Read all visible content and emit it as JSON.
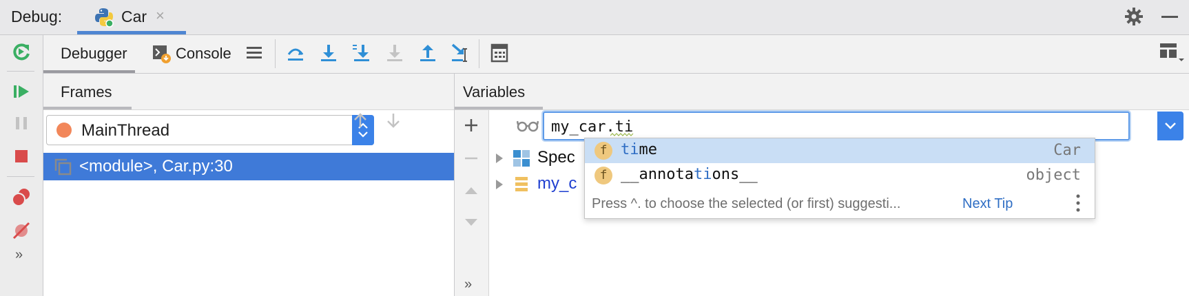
{
  "titlebar": {
    "label": "Debug:",
    "tab_name": "Car",
    "close_glyph": "×",
    "icons": {
      "app": "python-icon",
      "settings": "gear-icon",
      "hide": "minimize-icon"
    }
  },
  "sidebar": {
    "icons": [
      "rerun-icon",
      "resume-icon",
      "pause-icon",
      "stop-icon",
      "view-breakpoints-icon",
      "mute-breakpoints-icon"
    ],
    "more": "»"
  },
  "toolbar": {
    "tabs": [
      {
        "label": "Debugger",
        "active": true
      },
      {
        "label": "Console",
        "active": false
      }
    ],
    "icons": [
      "frames-menu-icon",
      "show-execution-point-icon",
      "step-over-icon",
      "step-into-icon",
      "step-into-my-code-icon",
      "force-step-into-icon",
      "step-out-icon",
      "run-to-cursor-icon",
      "evaluate-expression-icon",
      "layout-icon"
    ]
  },
  "frames": {
    "header": "Frames",
    "thread": "MainThread",
    "frame_row": "<module>, Car.py:30"
  },
  "variables": {
    "header": "Variables",
    "eval_value": "my_car.ti",
    "rows": [
      {
        "label": "Spec"
      },
      {
        "label": "my_c"
      }
    ],
    "more": "»"
  },
  "completion": {
    "items": [
      {
        "badge": "f",
        "name_hl": "ti",
        "name_rest": "me",
        "type": "Car",
        "selected": true
      },
      {
        "badge": "f",
        "name_pre": "__annota",
        "name_hl": "ti",
        "name_post": "ons__",
        "type": "object",
        "selected": false
      }
    ],
    "hint": "Press ^. to choose the selected (or first) suggesti...",
    "tip_link": "Next Tip"
  },
  "colors": {
    "accent": "#3b82e8",
    "selection": "#3f7ad8",
    "thread_dot": "#f2875a",
    "step_icon_blue": "#2f8fd6",
    "resume_green": "#3aaf63",
    "stop_red": "#d94b4b"
  }
}
